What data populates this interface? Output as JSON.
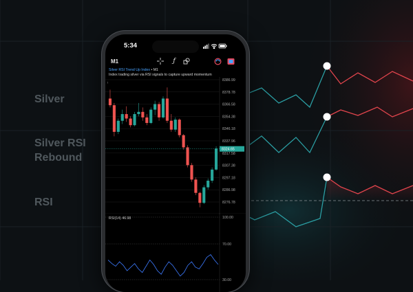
{
  "background_labels": {
    "silver": "Silver",
    "rsi_rebound_line1": "Silver RSI",
    "rsi_rebound_line2": "Rebound",
    "rsi": "RSI"
  },
  "status_bar": {
    "time": "5:34"
  },
  "toolbar": {
    "timeframe": "M1",
    "crosshair_icon": "crosshair-icon",
    "indicators_icon": "function-icon",
    "objects_icon": "shapes-icon",
    "trade_icon": "trade-icon",
    "account_icon": "account-icon"
  },
  "chart": {
    "title": "Silver RSI Trend Up Index",
    "title_suffix": "• M1",
    "subtitle": "Index trading silver via RSI signals to capture upward momentum",
    "price_ticks": [
      "8386.99",
      "8378.78",
      "8366.58",
      "8354.38",
      "8346.18",
      "8337.96",
      "8317.58",
      "8307.38",
      "8297.18",
      "8286.98",
      "8276.78"
    ],
    "current_price": "8324.65",
    "candles": [
      {
        "o": 8370,
        "h": 8378,
        "l": 8362,
        "c": 8364
      },
      {
        "o": 8364,
        "h": 8366,
        "l": 8336,
        "c": 8340
      },
      {
        "o": 8340,
        "h": 8352,
        "l": 8338,
        "c": 8350
      },
      {
        "o": 8350,
        "h": 8360,
        "l": 8347,
        "c": 8356
      },
      {
        "o": 8356,
        "h": 8363,
        "l": 8349,
        "c": 8352
      },
      {
        "o": 8352,
        "h": 8354,
        "l": 8344,
        "c": 8346
      },
      {
        "o": 8346,
        "h": 8358,
        "l": 8345,
        "c": 8356
      },
      {
        "o": 8356,
        "h": 8366,
        "l": 8354,
        "c": 8358
      },
      {
        "o": 8358,
        "h": 8362,
        "l": 8350,
        "c": 8353
      },
      {
        "o": 8353,
        "h": 8356,
        "l": 8346,
        "c": 8348
      },
      {
        "o": 8348,
        "h": 8362,
        "l": 8347,
        "c": 8360
      },
      {
        "o": 8360,
        "h": 8368,
        "l": 8355,
        "c": 8365
      },
      {
        "o": 8365,
        "h": 8367,
        "l": 8350,
        "c": 8353
      },
      {
        "o": 8353,
        "h": 8372,
        "l": 8352,
        "c": 8370
      },
      {
        "o": 8370,
        "h": 8380,
        "l": 8348,
        "c": 8350
      },
      {
        "o": 8350,
        "h": 8356,
        "l": 8340,
        "c": 8342
      },
      {
        "o": 8342,
        "h": 8353,
        "l": 8340,
        "c": 8351
      },
      {
        "o": 8351,
        "h": 8352,
        "l": 8335,
        "c": 8337
      },
      {
        "o": 8337,
        "h": 8338,
        "l": 8324,
        "c": 8326
      },
      {
        "o": 8326,
        "h": 8328,
        "l": 8308,
        "c": 8310
      },
      {
        "o": 8310,
        "h": 8312,
        "l": 8295,
        "c": 8297
      },
      {
        "o": 8297,
        "h": 8299,
        "l": 8283,
        "c": 8285
      },
      {
        "o": 8285,
        "h": 8286,
        "l": 8272,
        "c": 8276
      },
      {
        "o": 8276,
        "h": 8292,
        "l": 8275,
        "c": 8290
      },
      {
        "o": 8290,
        "h": 8298,
        "l": 8288,
        "c": 8296
      },
      {
        "o": 8296,
        "h": 8308,
        "l": 8294,
        "c": 8306
      },
      {
        "o": 8306,
        "h": 8327,
        "l": 8305,
        "c": 8325
      }
    ],
    "colors": {
      "up": "#26a69a",
      "down": "#ef5350",
      "bg": "#000000",
      "grid": "#1e1e1e",
      "current": "#26a69a"
    }
  },
  "rsi_pane": {
    "label": "RSI(14) 46.98",
    "ticks": [
      "100.00",
      "70.00",
      "30.00"
    ],
    "values": [
      52,
      48,
      45,
      50,
      46,
      40,
      44,
      48,
      42,
      38,
      45,
      52,
      47,
      40,
      36,
      44,
      50,
      46,
      40,
      34,
      38,
      46,
      50,
      44,
      42,
      48,
      55,
      58,
      52,
      47
    ]
  }
}
